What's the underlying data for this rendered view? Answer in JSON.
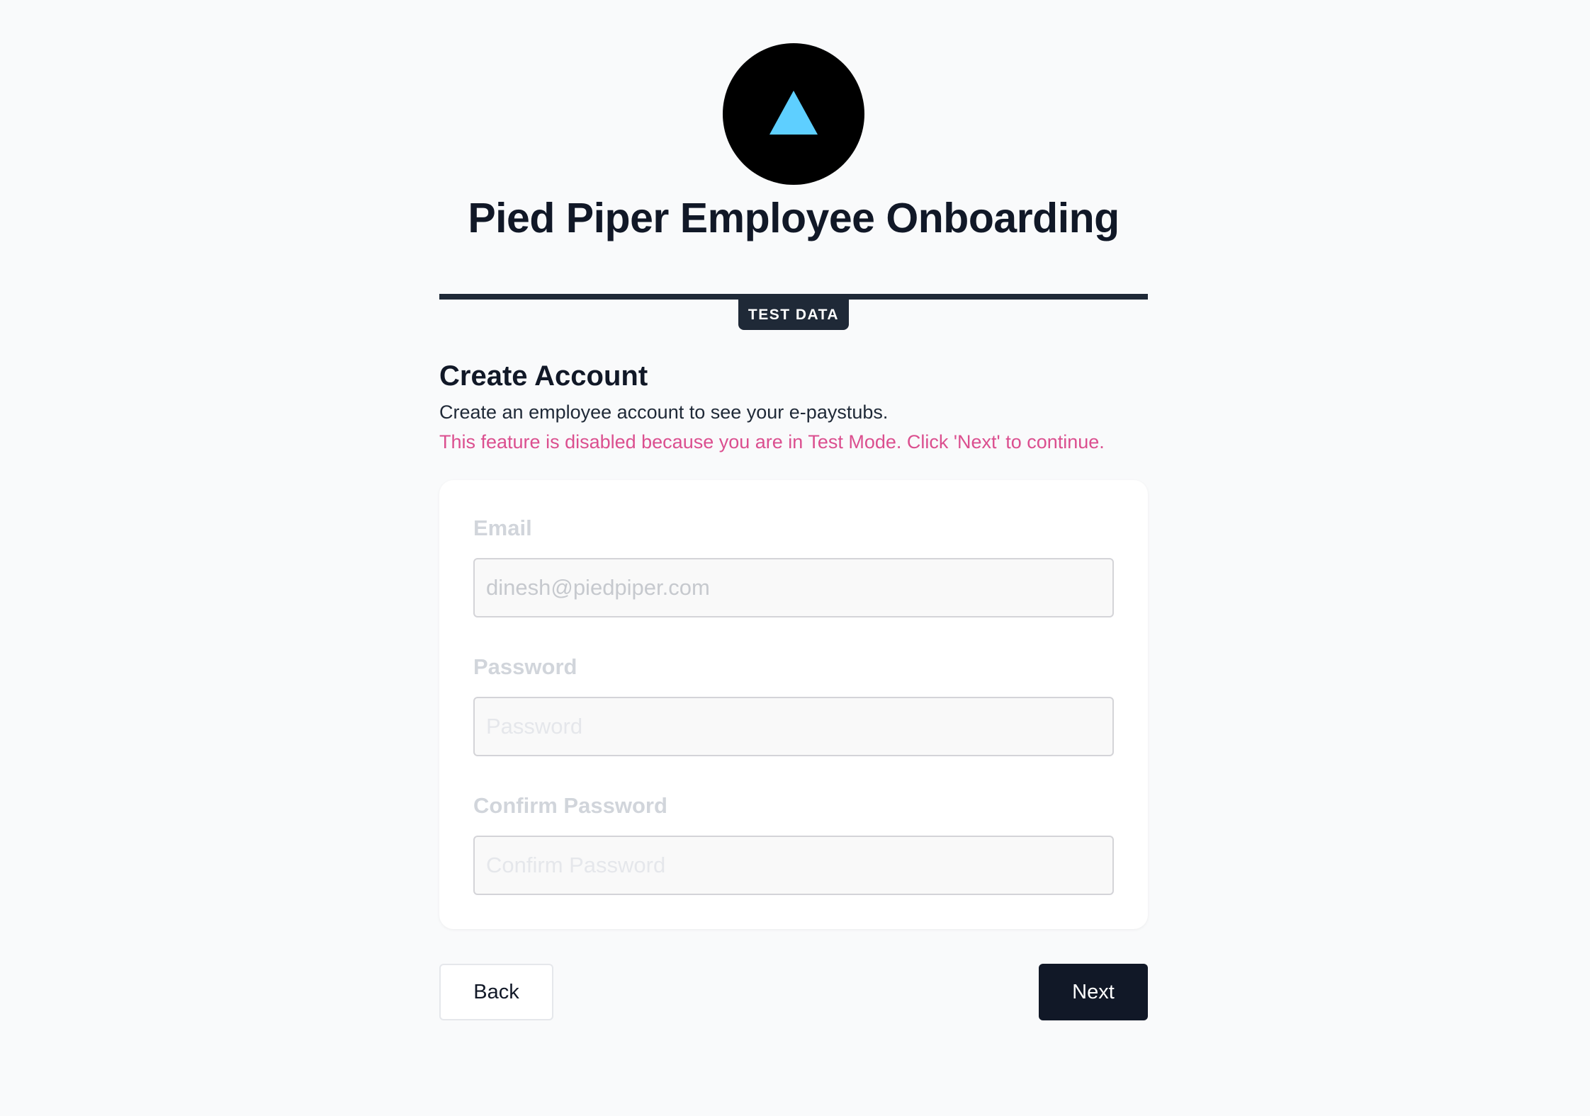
{
  "header": {
    "logo_icon": "triangle-icon",
    "logo_bg_color": "#000000",
    "logo_triangle_color": "#5ecfff",
    "title": "Pied Piper Employee Onboarding"
  },
  "banner": {
    "badge": "TEST DATA"
  },
  "section": {
    "title": "Create Account",
    "description": "Create an employee account to see your e-paystubs.",
    "notice": "This feature is disabled because you are in Test Mode. Click 'Next' to continue.",
    "notice_color": "#db4f8f"
  },
  "form": {
    "email": {
      "label": "Email",
      "value": "dinesh@piedpiper.com",
      "placeholder": "Email"
    },
    "password": {
      "label": "Password",
      "value": "",
      "placeholder": "Password"
    },
    "confirm_password": {
      "label": "Confirm Password",
      "value": "",
      "placeholder": "Confirm Password"
    }
  },
  "actions": {
    "back_label": "Back",
    "next_label": "Next",
    "primary_color": "#111827"
  }
}
